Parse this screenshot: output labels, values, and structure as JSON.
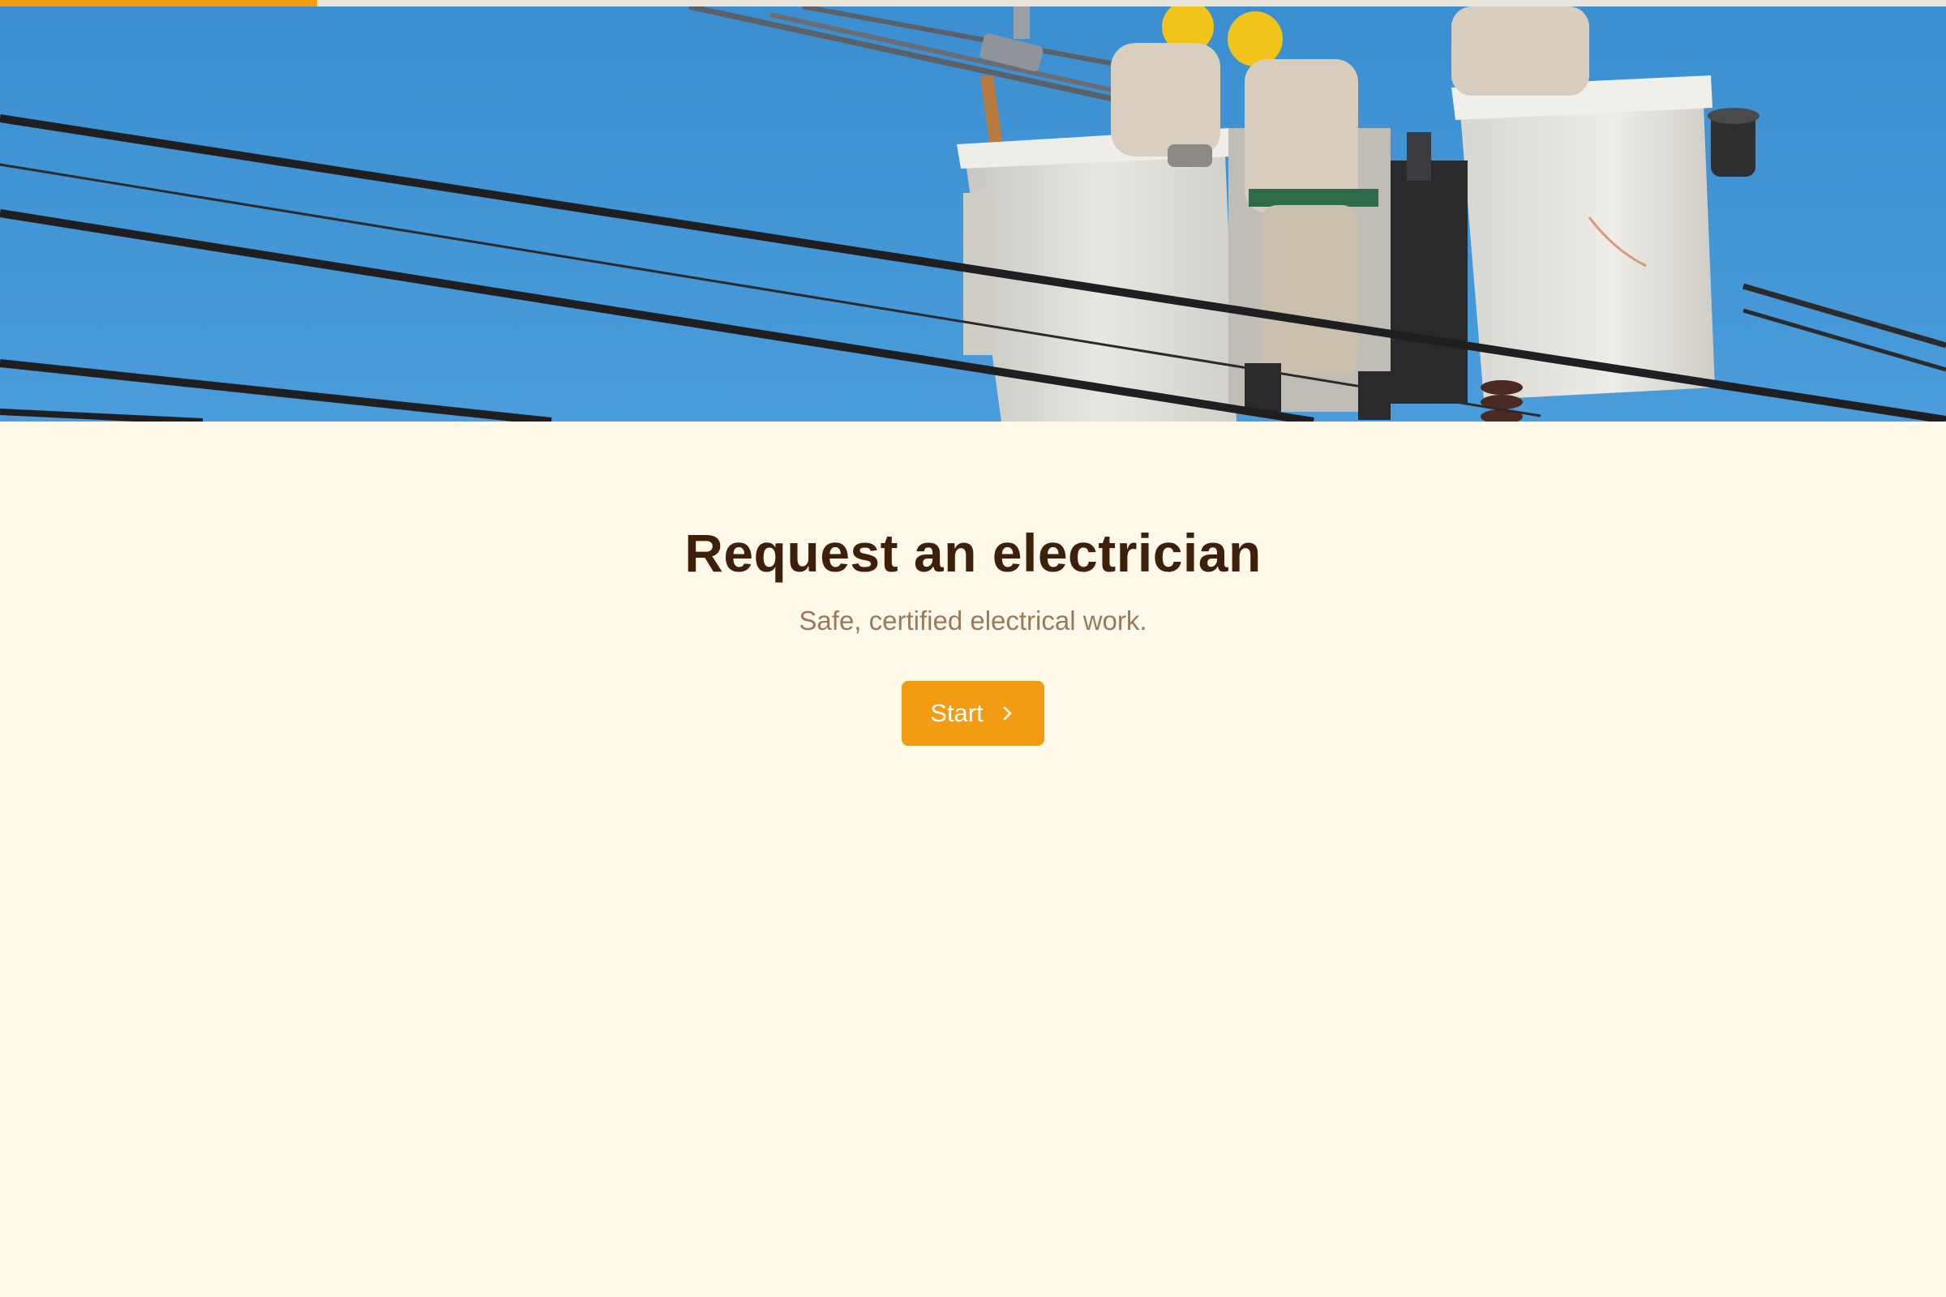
{
  "progress": {
    "fraction": 0.163,
    "fill_color": "#f39c12",
    "track_color": "#ebe6dc"
  },
  "hero": {
    "image_description_icon": "electricians-bucket-truck-image",
    "sky_color": "#3f95d4"
  },
  "main": {
    "title": "Request an electrician",
    "subtitle": "Safe, certified electrical work.",
    "start_button_label": "Start",
    "start_button_icon": "chevron-right-icon"
  },
  "colors": {
    "accent": "#f39c12",
    "background": "#fef9e8",
    "title": "#3d1f0a",
    "subtitle": "#9b7a5b"
  }
}
